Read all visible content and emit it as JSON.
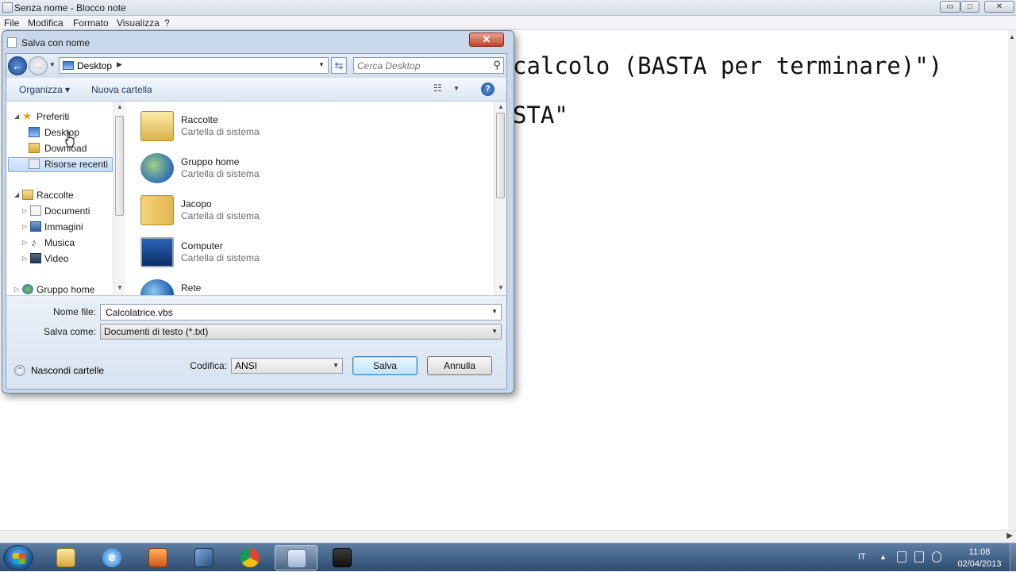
{
  "notepad": {
    "title": "Senza nome - Blocco note",
    "menu": [
      "File",
      "Modifica",
      "Formato",
      "Visualizza",
      "?"
    ],
    "text_lines": [
      "calcolo (BASTA per terminare)\")",
      "STA\""
    ],
    "controls": {
      "minimize": "▭",
      "maximize": "□",
      "close": "✕"
    }
  },
  "dialog": {
    "title": "Salva con nome",
    "close": "✕",
    "address": {
      "location": "Desktop",
      "separator": "▶"
    },
    "search": {
      "placeholder": "Cerca Desktop"
    },
    "toolbar": {
      "organize": "Organizza ▾",
      "new_folder": "Nuova cartella",
      "help": "?"
    },
    "nav": {
      "favorites": "Preferiti",
      "favorites_items": [
        "Desktop",
        "Download",
        "Risorse recenti"
      ],
      "libraries": "Raccolte",
      "libraries_items": [
        "Documenti",
        "Immagini",
        "Musica",
        "Video"
      ],
      "homegroup": "Gruppo home"
    },
    "files": [
      {
        "name": "Raccolte",
        "desc": "Cartella di sistema",
        "icon": "libraries-folder-icon"
      },
      {
        "name": "Gruppo home",
        "desc": "Cartella di sistema",
        "icon": "homegroup-icon"
      },
      {
        "name": "Jacopo",
        "desc": "Cartella di sistema",
        "icon": "user-folder-icon"
      },
      {
        "name": "Computer",
        "desc": "Cartella di sistema",
        "icon": "computer-icon"
      },
      {
        "name": "Rete",
        "desc": "",
        "icon": "network-icon"
      }
    ],
    "form": {
      "filename_label": "Nome file:",
      "filename_value": "Calcolatrice.vbs",
      "filetype_label": "Salva come:",
      "filetype_value": "Documenti di testo (*.txt)",
      "hide_folders": "Nascondi cartelle",
      "encoding_label": "Codifica:",
      "encoding_value": "ANSI",
      "save": "Salva",
      "cancel": "Annulla"
    }
  },
  "taskbar": {
    "language": "IT",
    "time": "11:08",
    "date": "02/04/2013"
  },
  "colors": {
    "dialog_frame": "#c9d8ea",
    "selection": "#c1dcfb",
    "taskbar": "#2e4b70",
    "close_button": "#c2432a"
  }
}
